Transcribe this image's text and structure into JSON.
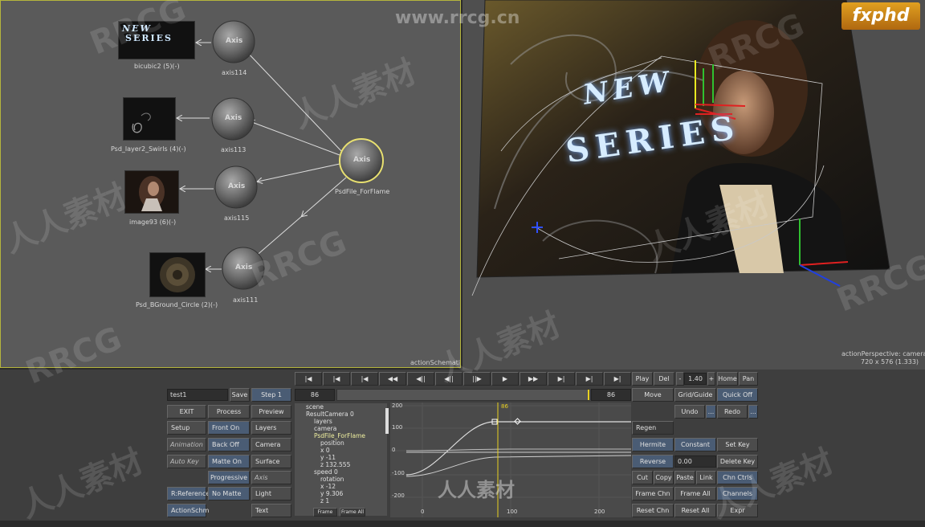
{
  "watermarks": {
    "site": "www.rrcg.cn",
    "brand": "fxphd",
    "rrcg": "RRCG",
    "cn": "人人素材",
    "cn2": "人人素材"
  },
  "schematic": {
    "panel_label": "actionSchematic",
    "root_node": {
      "title": "Axis",
      "label": "PsdFile_ForFlame"
    },
    "axes": [
      {
        "title": "Axis",
        "label": "axis114"
      },
      {
        "title": "Axis",
        "label": "axis113"
      },
      {
        "title": "Axis",
        "label": "axis115"
      },
      {
        "title": "Axis",
        "label": "axis111"
      }
    ],
    "media": [
      {
        "label": "bicubic2 (5)(-)",
        "thumb_text_1": "NEW",
        "thumb_text_2": "SERIES"
      },
      {
        "label": "Psd_layer2_Swirls (4)(-)"
      },
      {
        "label": "image93 (6)(-)"
      },
      {
        "label": "Psd_BGround_Circle (2)(-)"
      }
    ]
  },
  "viewport": {
    "line1": "actionPerspective: camera",
    "line2": "720 x 576 (1.333)",
    "title_1": "NEW",
    "title_2": "SERIES"
  },
  "transport": {
    "buttons": [
      "|◀",
      "|◀",
      "|◀",
      "◀◀",
      "◀||",
      "||▶",
      "▶",
      "▶▶",
      "▶|",
      "▶|",
      "▶|"
    ],
    "play": "Play",
    "del": "Del",
    "minus": "-",
    "speed": "1.40",
    "plus": "+",
    "home": "Home",
    "pan": "Pan"
  },
  "setup_row": {
    "name": "test1",
    "save": "Save",
    "step": "Step 1",
    "frame_left": "86",
    "frame_right": "86",
    "move": "Move",
    "grid": "Grid/Guide",
    "quick": "Quick Off"
  },
  "left_buttons": {
    "exit": "EXIT",
    "process": "Process",
    "preview": "Preview",
    "setup": "Setup",
    "front_on": "Front On",
    "layers": "Layers",
    "animation": "Animation",
    "back_off": "Back Off",
    "camera": "Camera",
    "auto_key": "Auto Key",
    "matte_on": "Matte On",
    "surface": "Surface",
    "progressive": "Progressive",
    "axis": "Axis",
    "rreference": "R:Reference",
    "no_matte": "No Matte",
    "light": "Light",
    "actionschm": "ActionSchm",
    "text": "Text"
  },
  "tree": {
    "items": [
      "scene",
      "ResultCamera 0",
      "layers",
      "camera",
      "PsdFile_ForFlame",
      "position",
      "x 0",
      "y -11",
      "z 132.555",
      "speed 0",
      "rotation",
      "x -12",
      "y 9.306",
      "z 1"
    ],
    "frame_btn": "Frame",
    "frame_all_btn": "Frame All"
  },
  "graph": {
    "cursor_frame": "86",
    "y_ticks": [
      "200",
      "100",
      "0",
      "-100",
      "-200"
    ],
    "x_ticks": [
      "0",
      "100",
      "200"
    ]
  },
  "right_buttons": {
    "undo": "Undo",
    "dots1": "...",
    "redo": "Redo",
    "dots2": "...",
    "regen": "Regen",
    "hermite": "Hermite",
    "constant": "Constant",
    "set_key": "Set Key",
    "reverse": "Reverse",
    "value": "0.00",
    "delete_key": "Delete Key",
    "cut": "Cut",
    "copy": "Copy",
    "paste": "Paste",
    "link": "Link",
    "chn_ctrls": "Chn Ctrls",
    "frame_chn": "Frame Chn",
    "frame_all": "Frame All",
    "channels": "Channels",
    "reset_chn": "Reset Chn",
    "reset_all": "Reset All",
    "expr": "Expr"
  },
  "colors": {
    "selection": "#b5b53c",
    "accent_blue": "#4a5c74",
    "cursor": "#e8d020"
  }
}
